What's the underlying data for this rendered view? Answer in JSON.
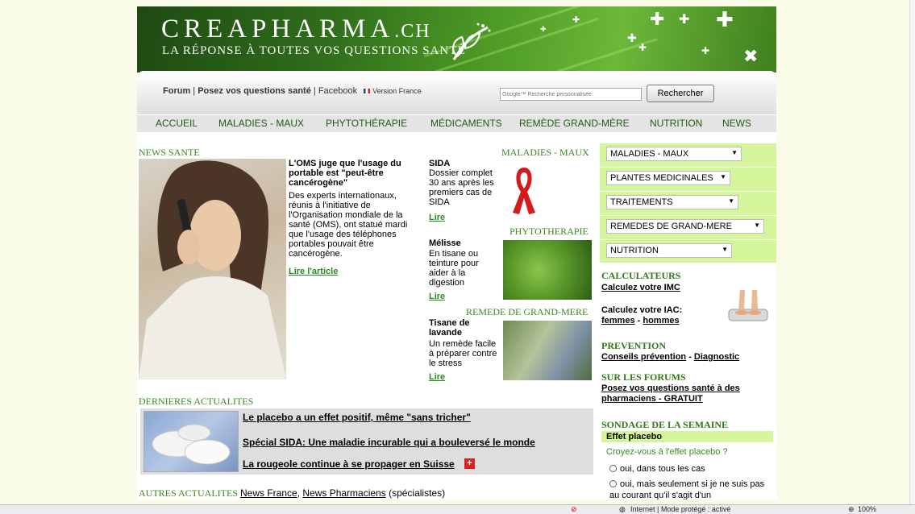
{
  "header": {
    "title_main": "CREAPHARMA",
    "title_suffix": ".CH",
    "tagline": "LA RÉPONSE À TOUTES VOS QUESTIONS SANTÉ"
  },
  "toplinks": {
    "forum": "Forum",
    "sep1": " | ",
    "questions": "Posez vos questions santé",
    "sep2": " | ",
    "facebook": "Facebook",
    "version": "Version France"
  },
  "search": {
    "placeholder": "Google™ Recherche personnalisée",
    "button": "Rechercher"
  },
  "nav": [
    "ACCUEIL",
    "MALADIES - MAUX",
    "PHYTOTHÉRAPIE",
    "MÉDICAMENTS",
    "REMÈDE GRAND-MÈRE",
    "NUTRITION",
    "NEWS"
  ],
  "news": {
    "section": "NEWS SANTE",
    "headline": "L'OMS juge que l'usage du portable est \"peut-être cancérogène\"",
    "body": "Des experts internationaux, réunis à l'initiative de l'Organisation mondiale de la santé (OMS), ont statué mardi que l'usage des téléphones portables pouvait être cancérogène.",
    "link": "Lire l'article"
  },
  "maladies": {
    "section": "MALADIES - MAUX",
    "title": "SIDA",
    "body": "Dossier complet 30 ans après les premiers cas de SIDA",
    "link": "Lire"
  },
  "phyto": {
    "section": "PHYTOTHERAPIE",
    "title": "Mélisse",
    "body": "En tisane ou teinture pour aider à la digestion",
    "link": "Lire"
  },
  "remede": {
    "section": "REMEDE DE GRAND-MERE",
    "title": "Tisane de lavande",
    "body": "Un remède facile à préparer contre le stress",
    "link": "Lire"
  },
  "actualites": {
    "section": "DERNIERES ACTUALITES",
    "items": [
      "Le placebo a un effet positif, même \"sans tricher\"",
      "Spécial SIDA: Une maladie incurable qui a bouleversé le monde",
      "La rougeole continue à se propager en Suisse"
    ]
  },
  "autres": {
    "label": "AUTRES ACTUALITES",
    "link1": "News France",
    "sep": ", ",
    "link2": "News Pharmaciens",
    "suffix": " (spécialistes)"
  },
  "dropdowns": [
    "MALADIES - MAUX",
    "PLANTES MEDICINALES",
    "TRAITEMENTS",
    "REMEDES DE GRAND-MERE",
    "NUTRITION"
  ],
  "calculateurs": {
    "title": "CALCULATEURS",
    "imc": "Calculez votre IMC",
    "iac": "Calculez votre IAC:",
    "femmes": "femmes",
    "dash": " - ",
    "hommes": "hommes"
  },
  "prevention": {
    "title": "PREVENTION",
    "conseils": "Conseils prévention",
    "dash": " - ",
    "diagnostic": "Diagnostic"
  },
  "forums": {
    "title": "SUR LES FORUMS",
    "line1": "Posez vos questions santé à des",
    "line2": "pharmaciens - GRATUIT"
  },
  "sondage": {
    "title": "SONDAGE DE LA SEMAINE",
    "subject": "Effet placebo",
    "question": "Croyez-vous à l'effet placebo ?",
    "option1": "oui, dans tous les cas",
    "option2": "oui, mais seulement si je ne suis pas au courant qu'il s'agit d'un"
  },
  "status": {
    "zone": "Internet | Mode protégé : activé",
    "zoom": "100%"
  },
  "colors": {
    "accent_green": "#3a8a1c",
    "panel_green": "#d4f59b",
    "page_bg": "#fbfbea"
  }
}
